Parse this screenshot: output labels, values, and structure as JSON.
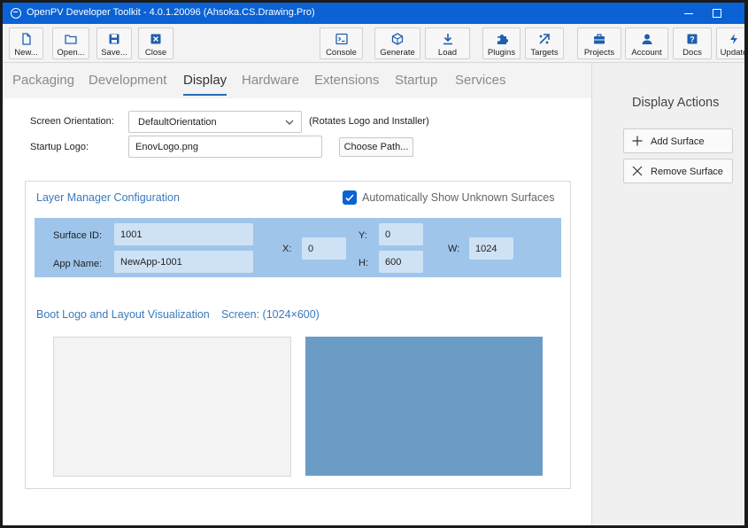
{
  "window": {
    "title": "OpenPV Developer Toolkit - 4.0.1.20096 (Ahsoka.CS.Drawing.Pro)"
  },
  "toolbar": {
    "new": "New...",
    "open": "Open...",
    "save": "Save...",
    "close": "Close",
    "console": "Console",
    "generate": "Generate",
    "load": "Load",
    "plugins": "Plugins",
    "targets": "Targets",
    "projects": "Projects",
    "account": "Account",
    "docs": "Docs",
    "update": "Update"
  },
  "tabs": [
    "Packaging",
    "Development",
    "Display",
    "Hardware",
    "Extensions",
    "Startup",
    "Services"
  ],
  "active_tab": "Display",
  "display": {
    "orientation_label": "Screen Orientation:",
    "orientation_value": "DefaultOrientation",
    "orientation_hint": "(Rotates Logo and Installer)",
    "logo_label": "Startup Logo:",
    "logo_value": "EnovLogo.png",
    "choose_path": "Choose Path..."
  },
  "layer_manager": {
    "title": "Layer Manager Configuration",
    "auto_show_label": "Automatically Show Unknown Surfaces",
    "auto_show_checked": true,
    "surface": {
      "id_label": "Surface ID:",
      "id_value": "1001",
      "app_label": "App Name:",
      "app_value": "NewApp-1001",
      "x_label": "X:",
      "x_value": "0",
      "y_label": "Y:",
      "y_value": "0",
      "h_label": "H:",
      "h_value": "600",
      "w_label": "W:",
      "w_value": "1024"
    }
  },
  "visualization": {
    "title": "Boot Logo and Layout Visualization",
    "screen": "Screen: (1024×600)"
  },
  "sidebar": {
    "title": "Display Actions",
    "add_surface": "Add Surface",
    "remove_surface": "Remove Surface"
  },
  "colors": {
    "accent": "#0a62d4",
    "band": "#9fc5ea",
    "layout_fill": "#6b9cc5"
  }
}
